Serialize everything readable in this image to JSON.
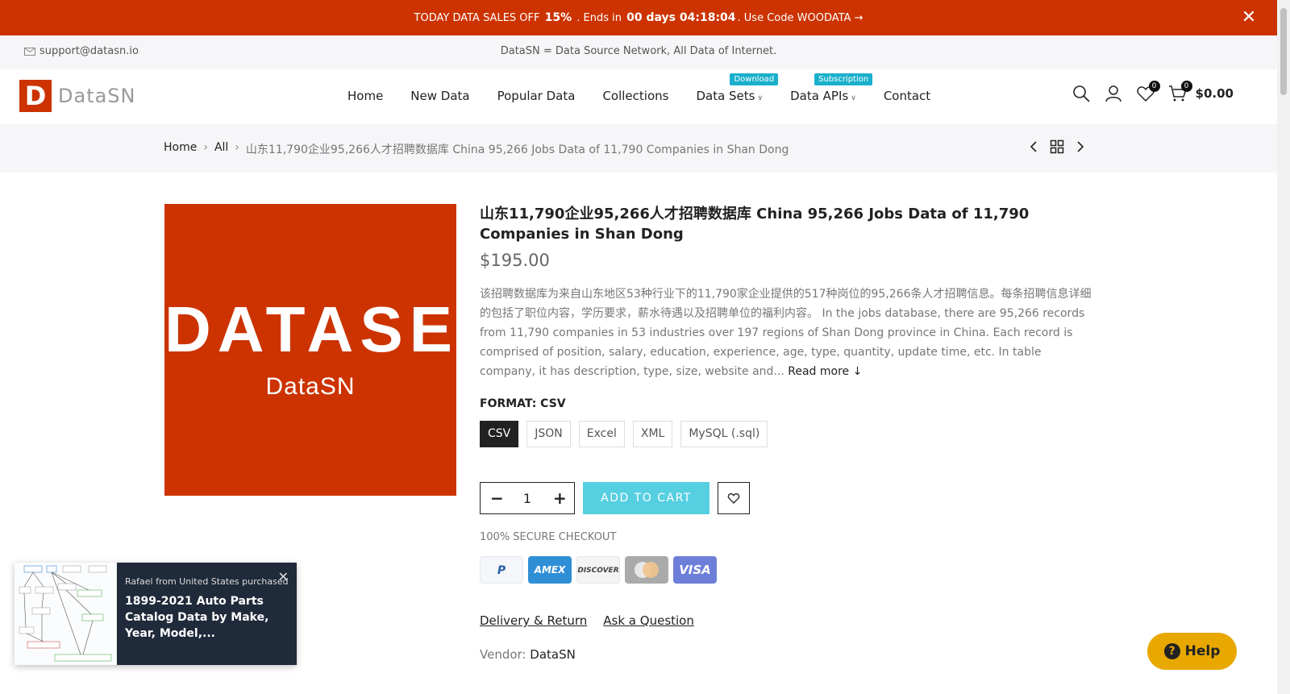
{
  "promo": {
    "prefix": "TODAY DATA SALES OFF",
    "discount": "15%",
    "ends_text": ". Ends in",
    "countdown": "00 days 04:18:04",
    "code_text": ". Use Code WOODATA →",
    "close": "✕"
  },
  "infobar": {
    "email": "support@datasn.io",
    "tagline": "DataSN = Data Source Network, All Data of Internet."
  },
  "header": {
    "logo_mark": "D",
    "logo_word": "DataSN",
    "nav": {
      "home": "Home",
      "new_data": "New Data",
      "popular_data": "Popular Data",
      "collections": "Collections",
      "data_sets": "Data Sets",
      "data_sets_badge": "Download",
      "data_apis": "Data APIs",
      "data_apis_badge": "Subscription",
      "contact": "Contact"
    },
    "wishlist_count": "0",
    "cart_count": "0",
    "cart_total": "$0.00"
  },
  "breadcrumb": {
    "home": "Home",
    "all": "All",
    "current": "山东11,790企业95,266人才招聘数据库 China 95,266 Jobs Data of 11,790 Companies in Shan Dong"
  },
  "product": {
    "image_text_big": "DATASET",
    "image_text_small": "DataSN",
    "title": "山东11,790企业95,266人才招聘数据库 China 95,266 Jobs Data of 11,790 Companies in Shan Dong",
    "price": "$195.00",
    "description": "该招聘数据库为来自山东地区53种行业下的11,790家企业提供的517种岗位的95,266条人才招聘信息。每条招聘信息详细的包括了职位内容，学历要求，薪水待遇以及招聘单位的福利内容。 In the jobs database, there are 95,266 records from 11,790 companies in 53 industries over 197 regions of Shan Dong province in China. Each record is comprised of position, salary, education, experience, age, type, quantity, update time, etc. In table company, it has description, type, size, website and...",
    "read_more": "Read more ↓",
    "format_label": "FORMAT: CSV",
    "formats": [
      "CSV",
      "JSON",
      "Excel",
      "XML",
      "MySQL (.sql)"
    ],
    "quantity": "1",
    "add_to_cart": "ADD TO CART",
    "secure_checkout": "100% SECURE CHECKOUT",
    "payments": [
      "PayPal",
      "AMEX",
      "DISCOVER",
      "Mastercard",
      "VISA"
    ],
    "link_delivery": "Delivery & Return",
    "link_question": "Ask a Question",
    "vendor_label": "Vendor:",
    "vendor": "DataSN"
  },
  "popup": {
    "who": "Rafael from United States purchased",
    "product": "1899-2021 Auto Parts Catalog Data by Make, Year, Model,..."
  },
  "help": {
    "label": "Help"
  },
  "colors": {
    "brand": "#cc3300",
    "accent": "#56cfe1",
    "badge": "#1ab0cc",
    "help": "#e8a800"
  }
}
